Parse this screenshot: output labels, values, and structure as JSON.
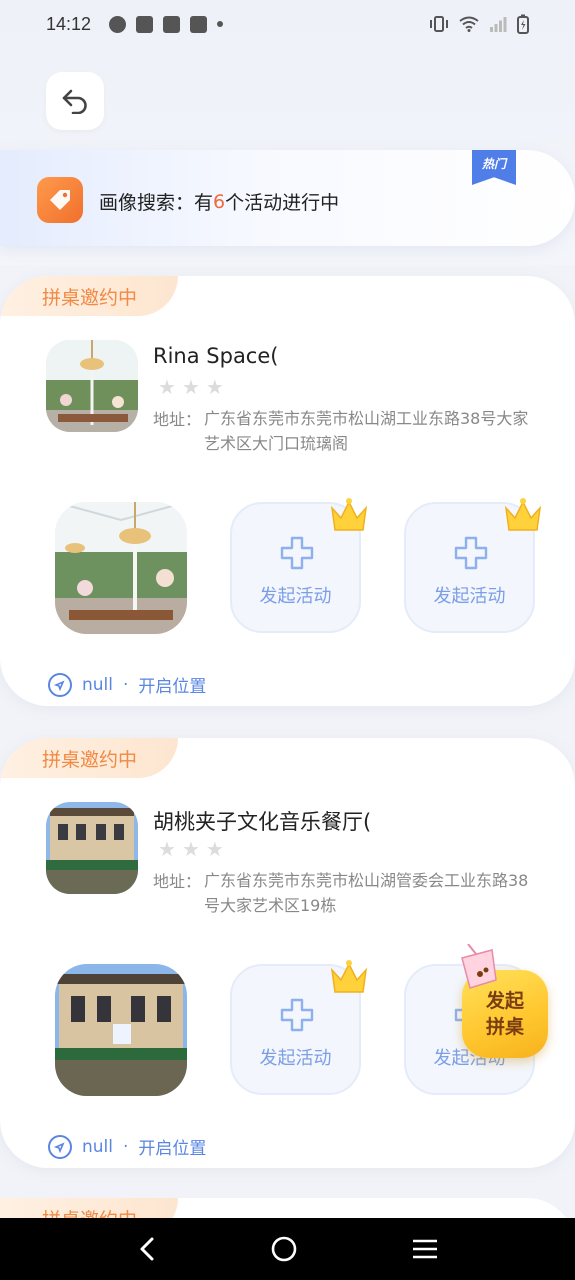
{
  "status_bar": {
    "time": "14:12",
    "icons": [
      "timer-icon",
      "mail-icon",
      "mail-icon",
      "mail-icon",
      "dot-icon"
    ],
    "right_icons": [
      "vibrate-icon",
      "wifi-icon",
      "signal-icon",
      "battery-icon"
    ]
  },
  "header": {
    "back_icon": "back-arrow-icon"
  },
  "banner": {
    "prefix": "画像搜索：有",
    "count": "6",
    "suffix": "个活动进行中",
    "hot_tag": "热门",
    "icon": "tag-icon"
  },
  "cards": [
    {
      "badge": "拼桌邀约中",
      "name": "Rina Space(",
      "rating_stars": 3,
      "address_label": "地址：",
      "address": "广东省东莞市东莞市松山湖工业东路38号大家艺术区大门口琉璃阁",
      "slots": [
        {
          "label": "发起活动"
        },
        {
          "label": "发起活动"
        }
      ],
      "location_value": "null",
      "location_separator": "·",
      "location_action": "开启位置"
    },
    {
      "badge": "拼桌邀约中",
      "name": "胡桃夹子文化音乐餐厅(",
      "rating_stars": 3,
      "address_label": "地址：",
      "address": "广东省东莞市东莞市松山湖管委会工业东路38号大家艺术区19栋",
      "slots": [
        {
          "label": "发起活动"
        },
        {
          "label": "发起活动"
        }
      ],
      "location_value": "null",
      "location_separator": "·",
      "location_action": "开启位置"
    }
  ],
  "peek_card": {
    "badge": "拼桌邀约中"
  },
  "float_button": {
    "line1": "发起",
    "line2": "拼桌"
  },
  "nav": {
    "back": "back-nav-icon",
    "home": "home-nav-icon",
    "menu": "menu-nav-icon"
  },
  "colors": {
    "accent_orange": "#f08a45",
    "accent_blue": "#5a86e2",
    "hot_blue": "#4f7ee8",
    "float_yellow": "#ffc62e"
  }
}
